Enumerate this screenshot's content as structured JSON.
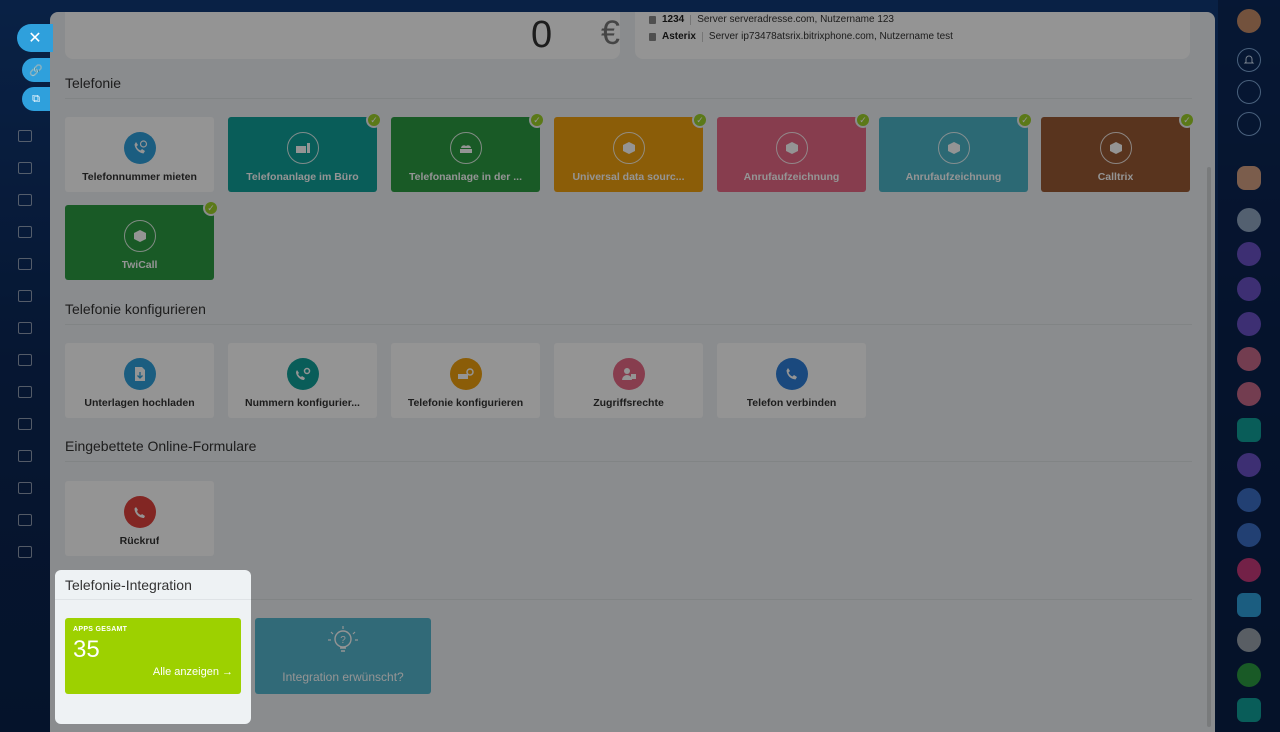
{
  "top": {
    "balance_value": "0",
    "currency_symbol": "€",
    "servers": [
      {
        "name": "1234",
        "detail": "Server serveradresse.com, Nutzername 123"
      },
      {
        "name": "Asterix",
        "detail": "Server ip73478atsrix.bitrixphone.com, Nutzername test"
      }
    ]
  },
  "sections": {
    "telefonie": {
      "title": "Telefonie",
      "tiles": [
        {
          "label": "Telefonnummer mieten",
          "color": "#ffffff",
          "icon": "phone-rent-icon",
          "checked": false
        },
        {
          "label": "Telefonanlage im Büro",
          "color": "#11a09a",
          "icon": "office-pbx-icon",
          "checked": true
        },
        {
          "label": "Telefonanlage in der ...",
          "color": "#2b9c43",
          "icon": "cloud-pbx-icon",
          "checked": true
        },
        {
          "label": "Universal data sourc...",
          "color": "#f0a10e",
          "icon": "box-icon",
          "checked": true
        },
        {
          "label": "Anrufaufzeichnung",
          "color": "#e86a87",
          "icon": "box-icon",
          "checked": true
        },
        {
          "label": "Anrufaufzeichnung",
          "color": "#4cb6c9",
          "icon": "box-icon",
          "checked": true
        },
        {
          "label": "Calltrix",
          "color": "#9a5a34",
          "icon": "box-icon",
          "checked": true
        },
        {
          "label": "TwiCall",
          "color": "#2b9c43",
          "icon": "box-icon",
          "checked": true
        }
      ]
    },
    "konfigurieren": {
      "title": "Telefonie konfigurieren",
      "tiles": [
        {
          "label": "Unterlagen hochladen",
          "icon_color": "#2fa0dc",
          "icon": "upload-document-icon"
        },
        {
          "label": "Nummern konfigurier...",
          "icon_color": "#11a09a",
          "icon": "number-settings-icon"
        },
        {
          "label": "Telefonie konfigurieren",
          "icon_color": "#f0a10e",
          "icon": "telephony-settings-icon"
        },
        {
          "label": "Zugriffsrechte",
          "icon_color": "#e86a87",
          "icon": "access-rights-icon"
        },
        {
          "label": "Telefon verbinden",
          "icon_color": "#2d7fd9",
          "icon": "connect-phone-icon"
        }
      ]
    },
    "formulare": {
      "title": "Eingebettete Online-Formulare",
      "tiles": [
        {
          "label": "Rückruf",
          "icon_color": "#e0423d",
          "icon": "callback-icon"
        }
      ]
    },
    "integration": {
      "title": "Telefonie-Integration",
      "apps_caption": "APPS GESAMT",
      "apps_count": "35",
      "apps_link": "Alle anzeigen →",
      "wish_label": "Integration erwünscht?"
    }
  },
  "colors": {
    "accent": "#2fa0dc",
    "check": "#9dd02a",
    "apps_green": "#9dd100",
    "wish_teal": "#55b7cf"
  }
}
